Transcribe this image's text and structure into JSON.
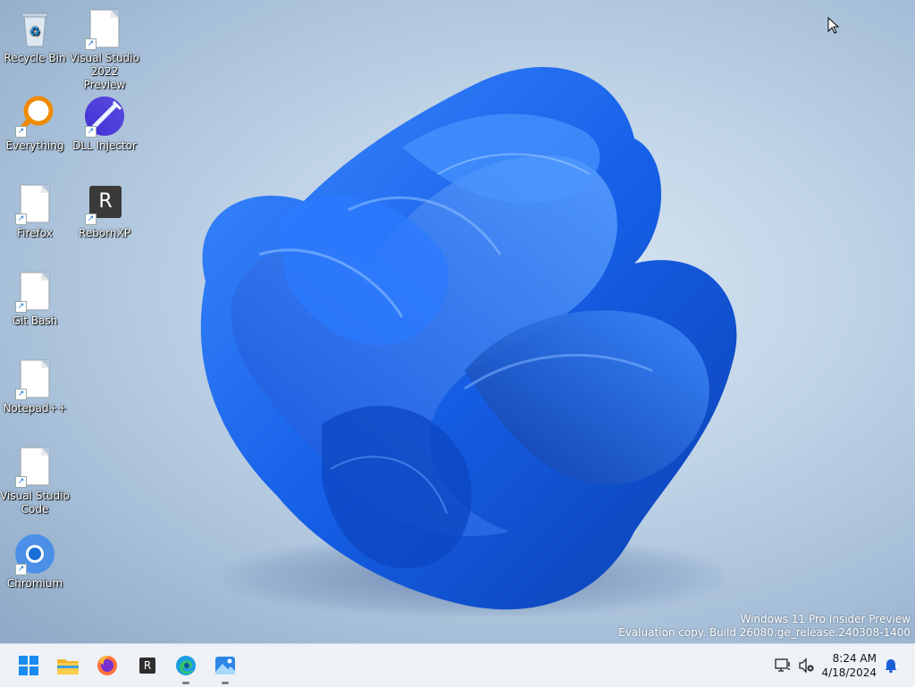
{
  "desktop_icons": [
    {
      "label": "Recycle Bin",
      "icon": "recycle-bin-icon"
    },
    {
      "label": "Visual Studio 2022 Preview",
      "icon": "file-icon"
    },
    {
      "label": "Everything",
      "icon": "everything-search-icon"
    },
    {
      "label": "DLL Injector",
      "icon": "syringe-icon"
    },
    {
      "label": "Firefox",
      "icon": "file-icon"
    },
    {
      "label": "RebornXP",
      "icon": "rebornxp-icon"
    },
    {
      "label": "Git Bash",
      "icon": "file-icon"
    },
    {
      "label": "Notepad++",
      "icon": "file-icon"
    },
    {
      "label": "Visual Studio Code",
      "icon": "file-icon"
    },
    {
      "label": "Chromium",
      "icon": "chromium-icon"
    }
  ],
  "watermark": {
    "line1": "Windows 11 Pro Insider Preview",
    "line2": "Evaluation copy. Build 26080.ge_release.240308-1400"
  },
  "taskbar": {
    "apps": [
      "start-icon",
      "file-explorer-icon",
      "firefox-icon",
      "rebornxp-icon",
      "edge-icon",
      "photos-icon"
    ],
    "rebornxp_letter": "R",
    "tray": {
      "network": "network-disconnected-icon",
      "volume": "volume-muted-icon",
      "notifications": "bell-icon"
    },
    "clock": {
      "time": "8:24 AM",
      "date": "4/18/2024"
    }
  },
  "colors": {
    "accent": "#1a5fd8",
    "taskbar": "#eef2f7"
  }
}
